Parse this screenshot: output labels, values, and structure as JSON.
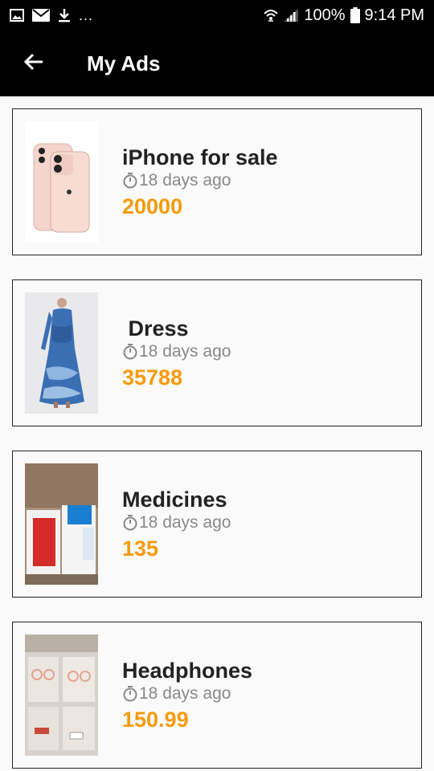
{
  "status_bar": {
    "battery": "100%",
    "time": "9:14 PM",
    "more": "...",
    "icons": [
      "image-icon",
      "mail-icon",
      "download-icon",
      "wifi-icon",
      "signal-icon",
      "battery-icon"
    ]
  },
  "app_bar": {
    "title": "My Ads",
    "back_icon": "arrow-left-icon"
  },
  "ads": [
    {
      "title": "iPhone for sale",
      "time": "18 days ago",
      "price": "20000",
      "image": "pink-iphone-photo"
    },
    {
      "title": " Dress",
      "time": "18 days ago",
      "price": "35788",
      "image": "blue-dress-photo"
    },
    {
      "title": "Medicines",
      "time": "18 days ago",
      "price": "135",
      "image": "medicine-boxes-photo"
    },
    {
      "title": "Headphones",
      "time": "18 days ago",
      "price": "150.99",
      "image": "headphones-rack-photo"
    }
  ],
  "colors": {
    "bar_bg": "#000000",
    "price": "#f59a0c",
    "title": "#222222",
    "meta": "#888888"
  }
}
